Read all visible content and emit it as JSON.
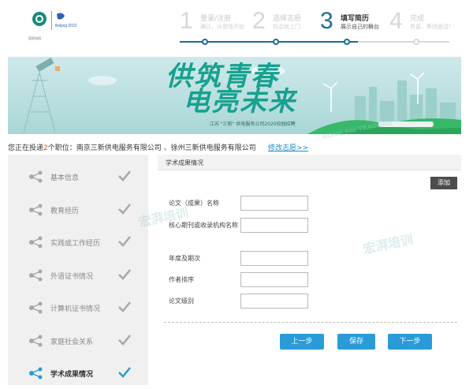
{
  "header": {
    "logo_text": "国家电网",
    "logo_partner": "Beijing 2022",
    "steps": [
      {
        "num": "1",
        "title": "登录/注册",
        "sub": "确认，从登陆开始",
        "active": false
      },
      {
        "num": "2",
        "title": "选择志愿",
        "sub": "机会就上门",
        "active": false
      },
      {
        "num": "3",
        "title": "填写简历",
        "sub": "展示自己的舞台",
        "active": true
      },
      {
        "num": "4",
        "title": "完成",
        "sub": "恭喜，等待面试！",
        "active": false
      }
    ],
    "progress": 0.66
  },
  "banner": {
    "line1": "供筑青春",
    "line2": "电亮未来",
    "subtitle": "江苏 \"三新\" 供电服务公司2020校园招聘"
  },
  "applying": {
    "prefix": "您正在投递",
    "count": "2",
    "suffix": "个职位：",
    "positions": "南京三新供电服务有限公司 、徐州三新供电服务有限公司",
    "modify_label": "修改志愿>>"
  },
  "sidebar": {
    "items": [
      {
        "label": "基本信息",
        "done": true,
        "active": false
      },
      {
        "label": "教育经历",
        "done": true,
        "active": false
      },
      {
        "label": "实践或工作经历",
        "done": true,
        "active": false
      },
      {
        "label": "外语证书情况",
        "done": true,
        "active": false
      },
      {
        "label": "计算机证书情况",
        "done": true,
        "active": false
      },
      {
        "label": "家庭社会关系",
        "done": true,
        "active": false
      },
      {
        "label": "学术成果情况",
        "done": true,
        "active": true
      }
    ]
  },
  "panel": {
    "title": "学术成果情况",
    "add_label": "添加",
    "fields": [
      {
        "label": "论文（成果）名称",
        "value": ""
      },
      {
        "label": "核心期刊或收录机构名称",
        "value": ""
      },
      {
        "label": "年度及期次",
        "value": ""
      },
      {
        "label": "作者排序",
        "value": ""
      },
      {
        "label": "论文级别",
        "value": ""
      }
    ],
    "buttons": {
      "prev": "上一步",
      "save": "保存",
      "next": "下一步"
    }
  },
  "watermark": {
    "cn": "宏湃培训",
    "en": "HONG PAI TRAINING"
  },
  "colors": {
    "primary": "#1b6c9a",
    "button": "#2a9bd8",
    "accent_teal": "#17a18f",
    "count_red": "#e0441c"
  }
}
